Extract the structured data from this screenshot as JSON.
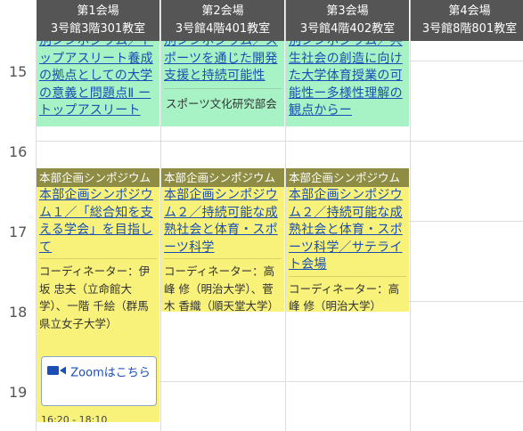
{
  "venues": [
    {
      "name": "第1会場",
      "room": "3号館3階301教室"
    },
    {
      "name": "第2会場",
      "room": "3号館4階401教室"
    },
    {
      "name": "第3会場",
      "room": "3号館4階402教室"
    },
    {
      "name": "第4会場",
      "room": "3号館8階801教室"
    }
  ],
  "hours": [
    "15",
    "16",
    "17",
    "18",
    "19"
  ],
  "green_events": [
    {
      "title": "別シンポジウム／トップアスリート養成の拠点としての大学の意義と問題点Ⅱ ートップアスリート",
      "info": ""
    },
    {
      "title": "別シンポジウム／スポーツを通じた開発支援と持続可能性",
      "info": "スポーツ文化研究部会"
    },
    {
      "title": "別シンポジウム／共生社会の創造に向けた大学体育授業の可能性ー多様性理解の観点からー",
      "info": ""
    }
  ],
  "yellow_events": [
    {
      "tag": "本部企画シンポジウム",
      "title": "本部企画シンポジウム１／「総合知を支える学会」を目指して",
      "info": "コーディネーター：伊坂 忠夫（立命館大学）、一階 千絵（群馬県立女子大学）",
      "zoom_label": "Zoomはこちら",
      "time": "16:20 - 18:10"
    },
    {
      "tag": "本部企画シンポジウム",
      "title": "本部企画シンポジウム２／持続可能な成熟社会と体育・スポーツ科学",
      "info": "コーディネーター：高峰 修（明治大学）、菅木 香織（順天堂大学）"
    },
    {
      "tag": "本部企画シンポジウム",
      "title": "本部企画シンポジウム２／持続可能な成熟社会と体育・スポーツ科学／サテライト会場",
      "info": "コーディネーター：高峰 修（明治大学）"
    }
  ],
  "colors": {
    "header_bg": "#555555",
    "green_event": "#a7f3c5",
    "yellow_event": "#f8f27b",
    "tag_bg": "#8e8d43",
    "link": "#1a4fb5"
  },
  "icons": {
    "zoom": "video-camera-icon"
  }
}
